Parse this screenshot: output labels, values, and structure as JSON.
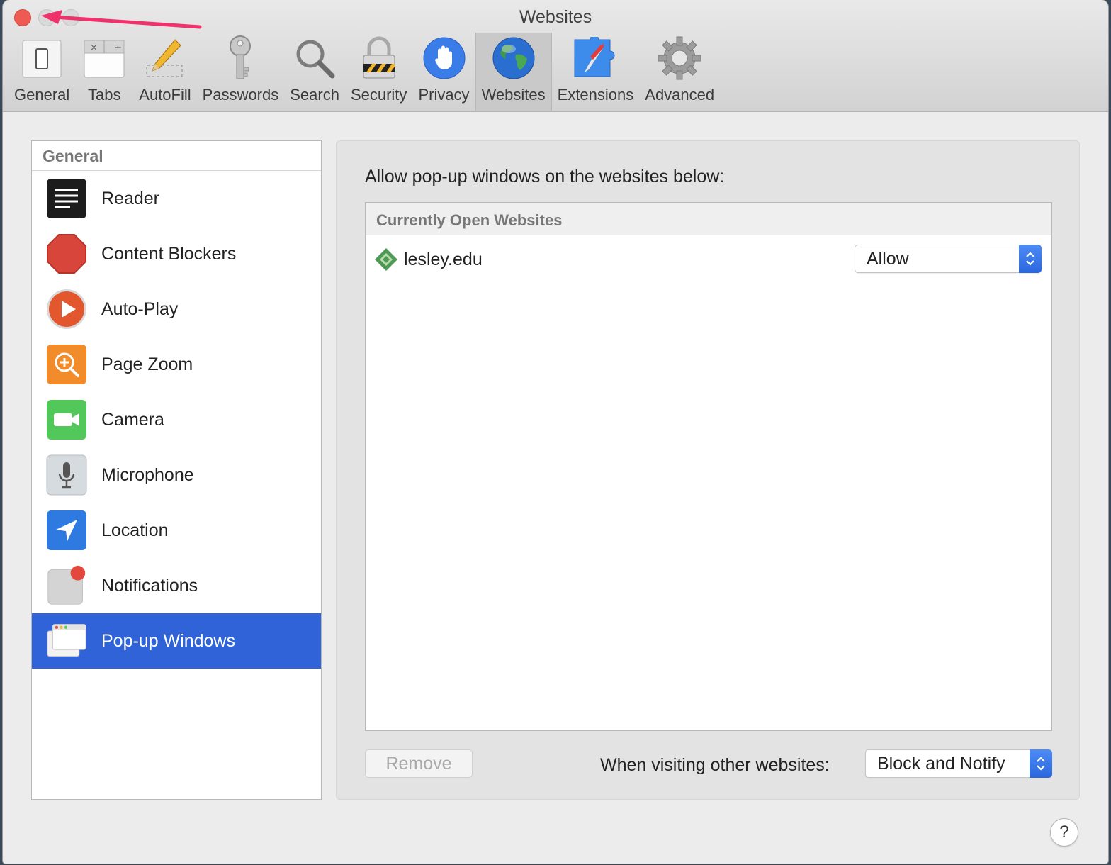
{
  "window": {
    "title": "Websites"
  },
  "toolbar": [
    {
      "label": "General",
      "icon": "general-icon"
    },
    {
      "label": "Tabs",
      "icon": "tabs-icon"
    },
    {
      "label": "AutoFill",
      "icon": "pencil-icon"
    },
    {
      "label": "Passwords",
      "icon": "key-icon"
    },
    {
      "label": "Search",
      "icon": "magnifier-icon"
    },
    {
      "label": "Security",
      "icon": "lock-icon"
    },
    {
      "label": "Privacy",
      "icon": "hand-icon"
    },
    {
      "label": "Websites",
      "icon": "globe-icon",
      "active": true
    },
    {
      "label": "Extensions",
      "icon": "puzzle-icon"
    },
    {
      "label": "Advanced",
      "icon": "gear-icon"
    }
  ],
  "sidebar": {
    "header": "General",
    "items": [
      {
        "label": "Reader",
        "icon": "reader-icon"
      },
      {
        "label": "Content Blockers",
        "icon": "stop-sign-icon"
      },
      {
        "label": "Auto-Play",
        "icon": "play-icon"
      },
      {
        "label": "Page Zoom",
        "icon": "zoom-icon"
      },
      {
        "label": "Camera",
        "icon": "camera-icon"
      },
      {
        "label": "Microphone",
        "icon": "microphone-icon"
      },
      {
        "label": "Location",
        "icon": "location-arrow-icon"
      },
      {
        "label": "Notifications",
        "icon": "notification-icon"
      },
      {
        "label": "Pop-up Windows",
        "icon": "popup-windows-icon",
        "selected": true
      }
    ]
  },
  "panel": {
    "heading": "Allow pop-up windows on the websites below:",
    "list_header": "Currently Open Websites",
    "rows": [
      {
        "site": "lesley.edu",
        "setting": "Allow"
      }
    ],
    "remove_label": "Remove",
    "other_label": "When visiting other websites:",
    "other_value": "Block and Notify",
    "help_label": "?"
  },
  "colors": {
    "selection": "#2f63d7",
    "close_button": "#ee5b53",
    "annotation_arrow": "#f0326c"
  }
}
